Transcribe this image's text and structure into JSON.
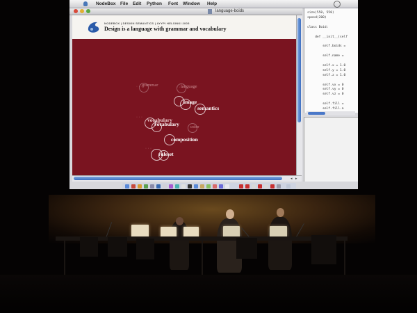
{
  "menubar": {
    "app_name": "NodeBox",
    "items": [
      "File",
      "Edit",
      "Python",
      "Font",
      "Window",
      "Help"
    ]
  },
  "window": {
    "title": "language-boids"
  },
  "slide": {
    "kicker": "NODEBOX | DESIGN SEMANTICS | AYYPI HELSINKI 2005",
    "title": "Design is a language with grammar and vocabulary",
    "words": {
      "grammar": "grammar",
      "language": "language",
      "image": "image",
      "semantics": "semantics",
      "vocabulary": "vocabulary",
      "color": "color",
      "composition": "composition",
      "ruleset": "ruleset"
    }
  },
  "code": {
    "lines": [
      "size(550, 550)",
      "speed(200)",
      "",
      "class Boid:",
      "",
      "    def __init__(self",
      "",
      "        self.boids =",
      "",
      "        self.name =",
      "",
      "        self.x = 1.0",
      "        self.y = 1.0",
      "        self.z = 1.0",
      "",
      "        self.vx = 0",
      "        self.vy = 0",
      "        self.vz = 0",
      "",
      "        self.fill =",
      "        self.fill.a"
    ]
  },
  "colors": {
    "canvas": "#7a1420",
    "accent_blue": "#3d6fc0",
    "stage_light": "#6a4a1e"
  }
}
